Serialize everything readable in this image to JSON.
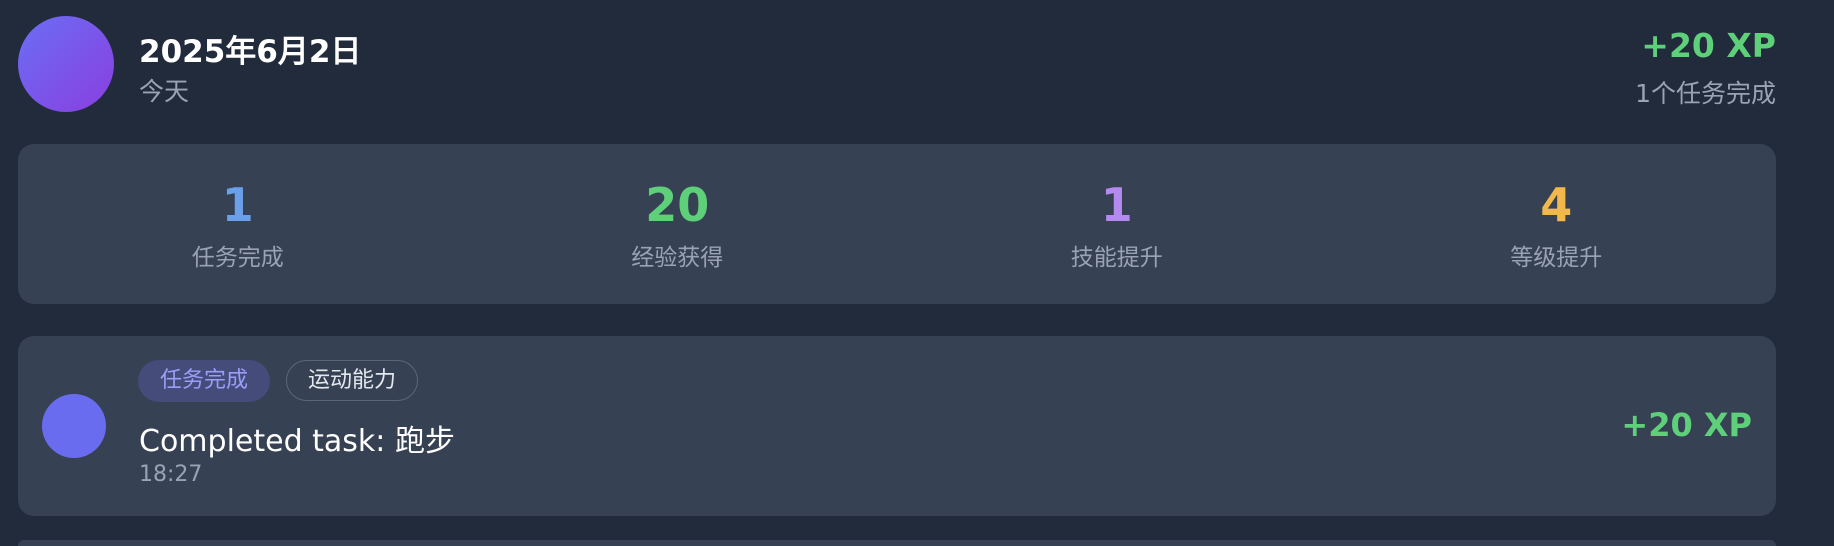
{
  "header": {
    "date": "2025年6月2日",
    "subtitle": "今天",
    "xp": "+20 XP",
    "summary": "1个任务完成"
  },
  "stats": [
    {
      "value": "1",
      "label": "任务完成",
      "color": "#6aa0ea"
    },
    {
      "value": "20",
      "label": "经验获得",
      "color": "#5fd07a"
    },
    {
      "value": "1",
      "label": "技能提升",
      "color": "#b58af0"
    },
    {
      "value": "4",
      "label": "等级提升",
      "color": "#f2b84b"
    }
  ],
  "activity": {
    "tags": [
      "任务完成",
      "运动能力"
    ],
    "title": "Completed task: 跑步",
    "time": "18:27",
    "xp": "+20 XP",
    "icon": "activity-dot-icon"
  },
  "colors": {
    "background": "#222b3b",
    "card": "#364254",
    "xp_green": "#5fd07a",
    "muted_text": "#9aa3b2"
  }
}
